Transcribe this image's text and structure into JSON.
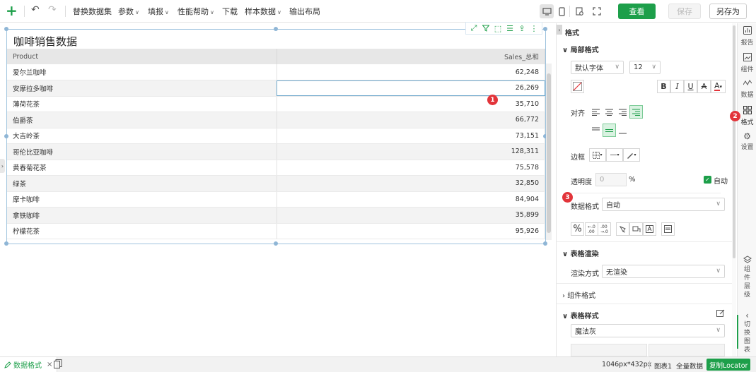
{
  "toolbar": {
    "menus": [
      {
        "label": "替换数据集",
        "caret": false
      },
      {
        "label": "参数",
        "caret": true
      },
      {
        "label": "填报",
        "caret": true
      },
      {
        "label": "性能帮助",
        "caret": true
      },
      {
        "label": "下载",
        "caret": false
      },
      {
        "label": "样本数据",
        "caret": true
      },
      {
        "label": "输出布局",
        "caret": false
      }
    ],
    "view_button": "查看",
    "save_button": "保存",
    "save_as_button": "另存为"
  },
  "widget": {
    "title": "咖啡销售数据",
    "columns": [
      "Product",
      "Sales_总和"
    ],
    "rows": [
      [
        "爱尔兰咖啡",
        "62,248"
      ],
      [
        "安摩拉多咖啡",
        "26,269"
      ],
      [
        "薄荷花茶",
        "35,710"
      ],
      [
        "伯爵茶",
        "66,772"
      ],
      [
        "大吉岭茶",
        "73,151"
      ],
      [
        "哥伦比亚咖啡",
        "128,311"
      ],
      [
        "黄春菊花茶",
        "75,578"
      ],
      [
        "绿茶",
        "32,850"
      ],
      [
        "摩卡咖啡",
        "84,904"
      ],
      [
        "拿铁咖啡",
        "35,899"
      ],
      [
        "柠檬花茶",
        "95,926"
      ]
    ],
    "selected_row": 1
  },
  "badges": [
    "1",
    "2",
    "3"
  ],
  "panel": {
    "title": "格式",
    "local_format": "局部格式",
    "font_family": "默认字体",
    "font_size": "12",
    "align_label": "对齐",
    "border_label": "边框",
    "opacity_label": "透明度",
    "opacity_value": "0",
    "opacity_unit": "%",
    "auto_label": "自动",
    "data_format_label": "数据格式",
    "data_format_value": "自动",
    "table_render": "表格渲染",
    "render_mode_label": "渲染方式",
    "render_mode_value": "无渲染",
    "component_format": "组件格式",
    "table_style": "表格样式",
    "table_style_value": "魔法灰"
  },
  "rail": {
    "items": [
      "报告",
      "组件",
      "数据",
      "格式",
      "设置"
    ],
    "layers": "组件层级",
    "switch_chart": "切换图表"
  },
  "status": {
    "tab_label": "数据格式",
    "size": "1046px*432px",
    "sheet": "图表1",
    "full_data": "全量数据",
    "locator": "复制Locator"
  },
  "colors": {
    "accent": "#1d9f4a",
    "badge": "#e2343a",
    "selection": "#6fa8cc"
  }
}
